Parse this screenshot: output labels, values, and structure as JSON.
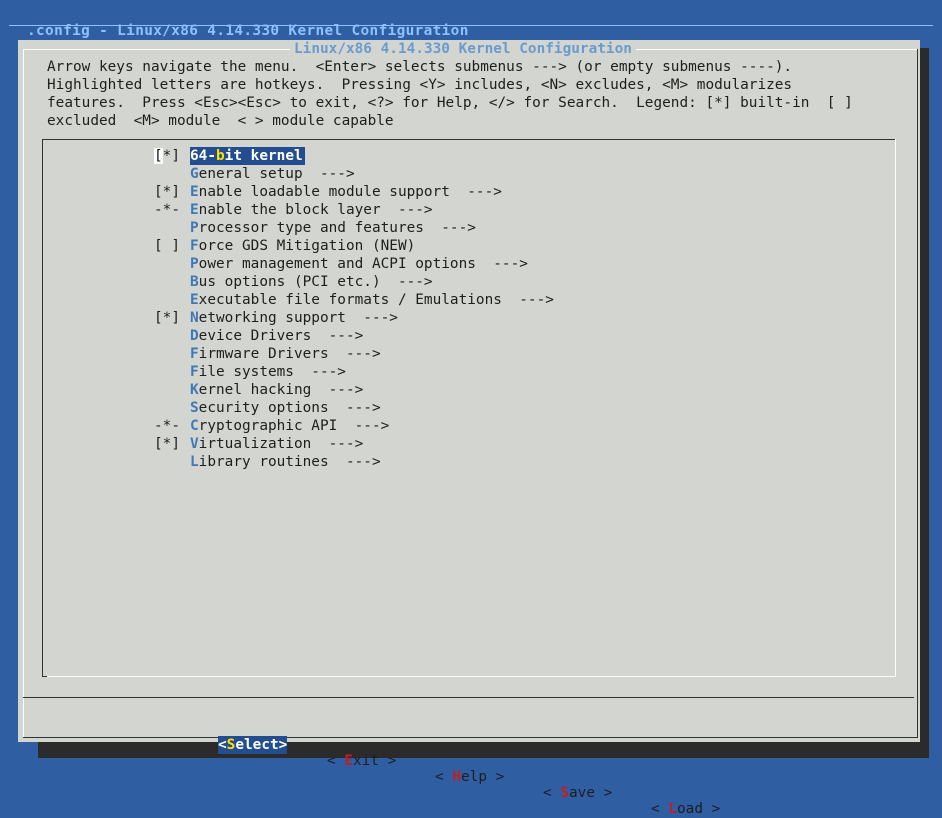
{
  "window_title": ".config - Linux/x86 4.14.330 Kernel Configuration",
  "dialog_title": "Linux/x86 4.14.330 Kernel Configuration",
  "help_lines": [
    "Arrow keys navigate the menu.  <Enter> selects submenus ---> (or empty submenus ----).",
    "Highlighted letters are hotkeys.  Pressing <Y> includes, <N> excludes, <M> modularizes",
    "features.  Press <Esc><Esc> to exit, <?> for Help, </> for Search.  Legend: [*] built-in  [ ]",
    "excluded  <M> module  < > module capable"
  ],
  "menu_items": [
    {
      "state": "[*]",
      "hotkey": "",
      "pre": "64-",
      "post": "bit kernel",
      "selected": true,
      "bold_letter": "b"
    },
    {
      "state": "",
      "hotkey": "G",
      "pre": "",
      "post": "eneral setup  --->"
    },
    {
      "state": "[*]",
      "hotkey": "E",
      "pre": "",
      "post": "nable loadable module support  --->"
    },
    {
      "state": "-*-",
      "hotkey": "E",
      "pre": "",
      "post": "nable the block layer  --->"
    },
    {
      "state": "",
      "hotkey": "P",
      "pre": "",
      "post": "rocessor type and features  --->"
    },
    {
      "state": "[ ]",
      "hotkey": "F",
      "pre": "",
      "post": "orce GDS Mitigation (NEW)"
    },
    {
      "state": "",
      "hotkey": "P",
      "pre": "",
      "post": "ower management and ACPI options  --->"
    },
    {
      "state": "",
      "hotkey": "B",
      "pre": "",
      "post": "us options (PCI etc.)  --->"
    },
    {
      "state": "",
      "hotkey": "E",
      "pre": "",
      "post": "xecutable file formats / Emulations  --->"
    },
    {
      "state": "[*]",
      "hotkey": "N",
      "pre": "",
      "post": "etworking support  --->"
    },
    {
      "state": "",
      "hotkey": "D",
      "pre": "",
      "post": "evice Drivers  --->"
    },
    {
      "state": "",
      "hotkey": "F",
      "pre": "",
      "post": "irmware Drivers  --->"
    },
    {
      "state": "",
      "hotkey": "F",
      "pre": "",
      "post": "ile systems  --->"
    },
    {
      "state": "",
      "hotkey": "K",
      "pre": "",
      "post": "ernel hacking  --->"
    },
    {
      "state": "",
      "hotkey": "S",
      "pre": "",
      "post": "ecurity options  --->"
    },
    {
      "state": "-*-",
      "hotkey": "C",
      "pre": "",
      "post": "ryptographic API  --->"
    },
    {
      "state": "[*]",
      "hotkey": "V",
      "pre": "",
      "post": "irtualization  --->"
    },
    {
      "state": "",
      "hotkey": "L",
      "pre": "",
      "post": "ibrary routines  --->"
    }
  ],
  "buttons": [
    {
      "pre": "<",
      "key": "S",
      "rest": "elect",
      "post": ">",
      "active": true
    },
    {
      "pre": "< ",
      "key": "E",
      "rest": "xit",
      "post": " >"
    },
    {
      "pre": "< ",
      "key": "H",
      "rest": "elp",
      "post": " >"
    },
    {
      "pre": "< ",
      "key": "S",
      "rest": "ave",
      "post": " >"
    },
    {
      "pre": "< ",
      "key": "L",
      "rest": "oad",
      "post": " >"
    }
  ],
  "colors": {
    "background": "#2f5ea3",
    "dialog": "#d3d6d0",
    "selection": "#234d8e",
    "hotkey": "#3f78b6",
    "button_hotkey": "#c02020"
  }
}
